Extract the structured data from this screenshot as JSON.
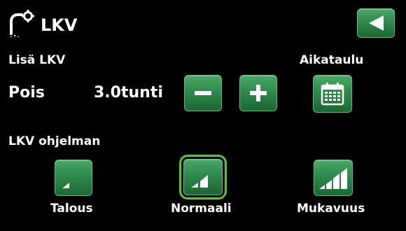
{
  "header": {
    "title": "LKV",
    "app_icon": "tap-gear-icon",
    "back_icon": "back-arrow-icon"
  },
  "extra_hot_water": {
    "section_label": "Lisä LKV",
    "state": "Pois",
    "duration": "3.0tunti",
    "minus_icon": "minus-icon",
    "plus_icon": "plus-icon"
  },
  "schedule": {
    "label": "Aikataulu",
    "icon": "calendar-icon"
  },
  "program": {
    "section_label": "LKV ohjelman",
    "options": [
      {
        "label": "Talous",
        "icon": "level-1-bars-icon",
        "selected": false
      },
      {
        "label": "Normaali",
        "icon": "level-2-bars-icon",
        "selected": true
      },
      {
        "label": "Mukavuus",
        "icon": "level-3-bars-icon",
        "selected": false
      }
    ]
  },
  "colors": {
    "button_green": "#2e8a4c",
    "selected_outline": "#5bc43a",
    "background": "#000000",
    "text": "#ffffff"
  }
}
